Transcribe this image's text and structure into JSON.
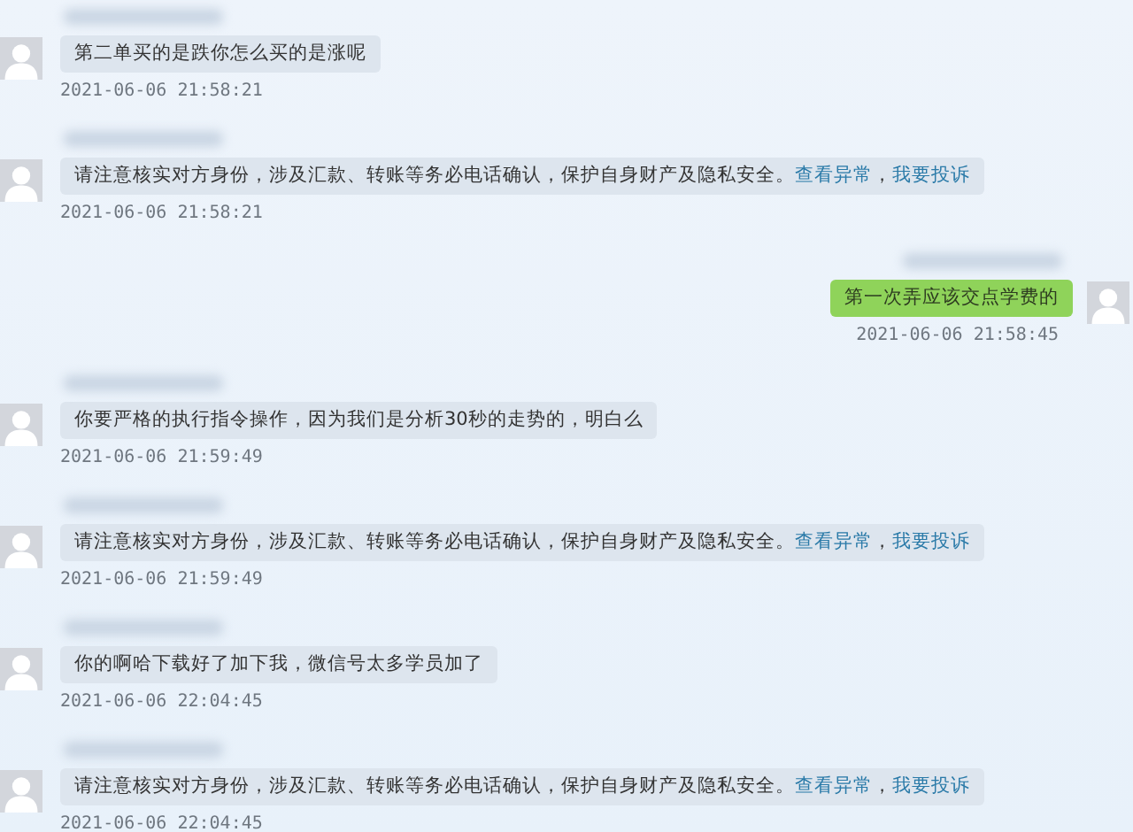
{
  "messages": [
    {
      "outgoing": false,
      "kind": "text",
      "text": "第二单买的是跌你怎么买的是涨呢",
      "time": "2021-06-06 21:58:21"
    },
    {
      "outgoing": false,
      "kind": "warning",
      "text": "请注意核实对方身份，涉及汇款、转账等务必电话确认，保护自身财产及隐私安全。",
      "links": [
        "查看异常",
        "我要投诉"
      ],
      "separator": "，",
      "time": "2021-06-06 21:58:21"
    },
    {
      "outgoing": true,
      "kind": "text",
      "text": "第一次弄应该交点学费的",
      "time": "2021-06-06 21:58:45"
    },
    {
      "outgoing": false,
      "kind": "text",
      "text": "你要严格的执行指令操作，因为我们是分析30秒的走势的，明白么",
      "time": "2021-06-06 21:59:49"
    },
    {
      "outgoing": false,
      "kind": "warning",
      "text": "请注意核实对方身份，涉及汇款、转账等务必电话确认，保护自身财产及隐私安全。",
      "links": [
        "查看异常",
        "我要投诉"
      ],
      "separator": "，",
      "time": "2021-06-06 21:59:49"
    },
    {
      "outgoing": false,
      "kind": "text",
      "text": "你的啊哈下载好了加下我，微信号太多学员加了",
      "time": "2021-06-06 22:04:45"
    },
    {
      "outgoing": false,
      "kind": "warning",
      "text": "请注意核实对方身份，涉及汇款、转账等务必电话确认，保护自身财产及隐私安全。",
      "links": [
        "查看异常",
        "我要投诉"
      ],
      "separator": "，",
      "time": "2021-06-06 22:04:45"
    }
  ]
}
